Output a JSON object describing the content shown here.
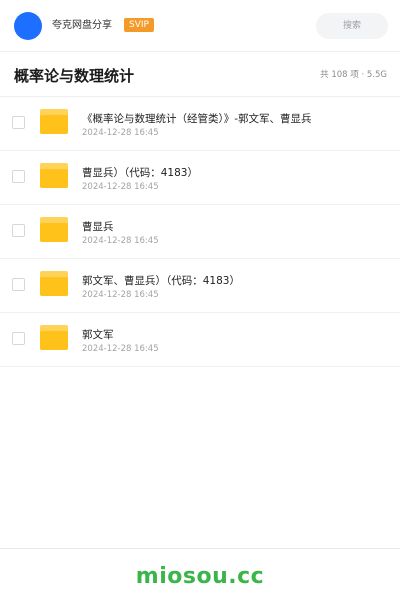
{
  "header": {
    "brand": "夸克网盘分享",
    "badge": "SVIP",
    "search_label": "搜索",
    "colors": {
      "avatar": "#1e6fff",
      "badge": "#f39a28"
    }
  },
  "folder_info": {
    "title": "概率论与数理统计",
    "count": "共 108 项 · 5.5G"
  },
  "files": [
    {
      "name": "《概率论与数理统计（经管类）》-郭文军、曹显兵",
      "date": "2024-12-28 16:45",
      "icon": "folder-icon"
    },
    {
      "name": "曹显兵）（代码：4183）",
      "date": "2024-12-28 16:45",
      "icon": "folder-icon"
    },
    {
      "name": "曹显兵",
      "date": "2024-12-28 16:45",
      "icon": "folder-icon"
    },
    {
      "name": "郭文军、曹显兵）（代码：4183）",
      "date": "2024-12-28 16:45",
      "icon": "folder-icon"
    },
    {
      "name": "郭文军",
      "date": "2024-12-28 16:45",
      "icon": "folder-icon"
    }
  ],
  "footer": {
    "watermark": "miosou.cc",
    "color": "#3bb54a"
  }
}
